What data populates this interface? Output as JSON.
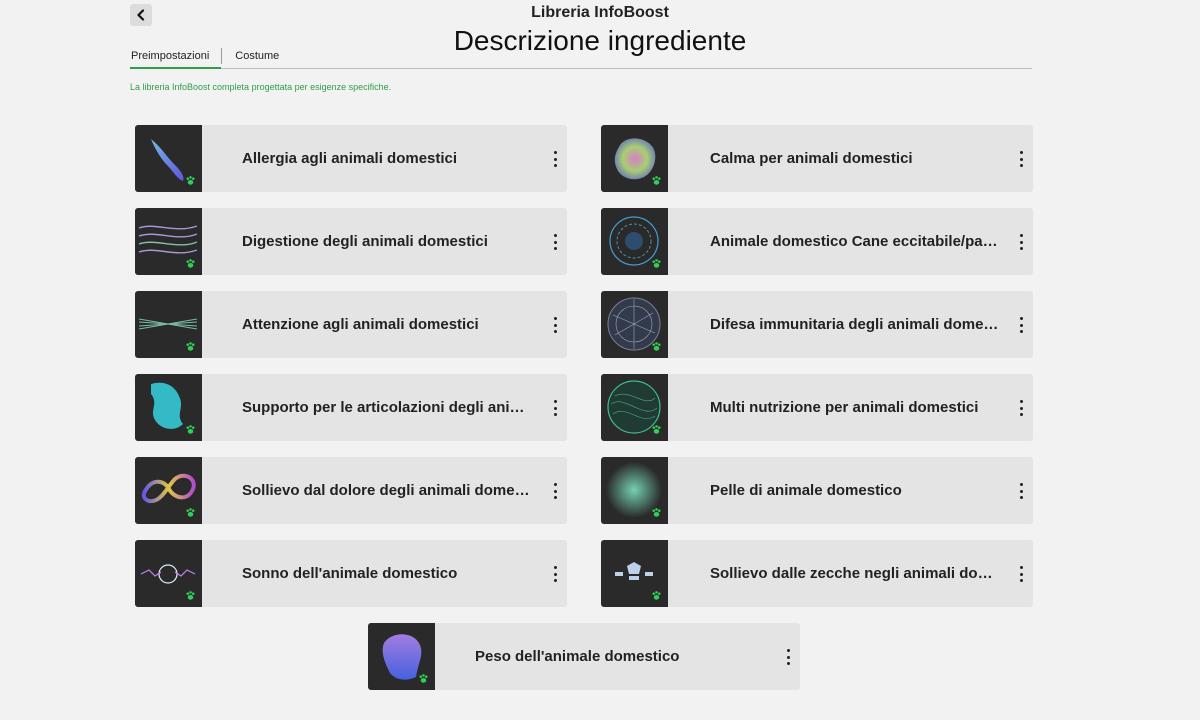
{
  "header": {
    "app_title": "Libreria InfoBoost",
    "page_title": "Descrizione ingrediente"
  },
  "tabs": [
    {
      "label": "Preimpostazioni",
      "active": true
    },
    {
      "label": "Costume",
      "active": false
    }
  ],
  "subtitle": "La libreria InfoBoost completa progettata per esigenze specifiche.",
  "colors": {
    "accent": "#2e9e4a",
    "card_bg": "#e4e4e4",
    "page_bg": "#f2f2f2",
    "thumb_bg": "#2a2a2a"
  },
  "items": [
    {
      "label": "Allergia agli animali domestici",
      "icon": "paw-icon"
    },
    {
      "label": "Calma per animali domestici",
      "icon": "paw-icon"
    },
    {
      "label": "Digestione degli animali domestici",
      "icon": "paw-icon"
    },
    {
      "label": "Animale domestico Cane eccitabile/pauroso",
      "icon": "paw-icon"
    },
    {
      "label": "Attenzione agli animali domestici",
      "icon": "paw-icon"
    },
    {
      "label": "Difesa immunitaria degli animali domestici",
      "icon": "paw-icon"
    },
    {
      "label": "Supporto per le articolazioni degli animali domestici",
      "icon": "paw-icon"
    },
    {
      "label": "Multi nutrizione per animali domestici",
      "icon": "paw-icon"
    },
    {
      "label": "Sollievo dal dolore degli animali domestici",
      "icon": "paw-icon"
    },
    {
      "label": "Pelle di animale domestico",
      "icon": "paw-icon"
    },
    {
      "label": "Sonno dell'animale domestico",
      "icon": "paw-icon"
    },
    {
      "label": "Sollievo dalle zecche negli animali domestici",
      "icon": "paw-icon"
    },
    {
      "label": "Peso dell'animale domestico",
      "icon": "paw-icon"
    }
  ]
}
